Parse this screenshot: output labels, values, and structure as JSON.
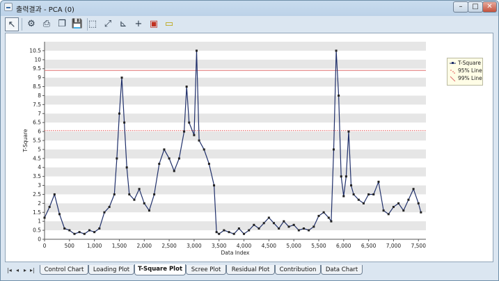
{
  "window": {
    "title": "출력결과 - PCA (0)"
  },
  "toolbar": {
    "items": [
      {
        "name": "pointer-icon",
        "glyph": "↖"
      },
      {
        "name": "properties-icon",
        "glyph": "⚙"
      },
      {
        "name": "print-icon",
        "glyph": "⎙"
      },
      {
        "name": "copy-icon",
        "glyph": "❐"
      },
      {
        "name": "save-icon",
        "glyph": "💾"
      },
      {
        "name": "zoom-icon",
        "glyph": "⬚"
      },
      {
        "name": "rescale-icon",
        "glyph": "⤢"
      },
      {
        "name": "axis-icon",
        "glyph": "⊾"
      },
      {
        "name": "crosshair-icon",
        "glyph": "+"
      },
      {
        "name": "export-icon",
        "glyph": "▣"
      },
      {
        "name": "label-icon",
        "glyph": "▭"
      }
    ]
  },
  "tabs": {
    "nav": [
      "|◂",
      "◂",
      "▸",
      "▸|"
    ],
    "items": [
      "Control Chart",
      "Loading Plot",
      "T-Square Plot",
      "Scree Plot",
      "Residual Plot",
      "Contribution",
      "Data Chart"
    ],
    "active": "T-Square Plot"
  },
  "chart_data": {
    "type": "line",
    "xlabel": "Data Index",
    "ylabel": "T-Square",
    "xlim": [
      0,
      7650
    ],
    "ylim": [
      0,
      11
    ],
    "xticks": [
      0,
      500,
      1000,
      1500,
      2000,
      2500,
      3000,
      3500,
      4000,
      4500,
      5000,
      5500,
      6000,
      6500,
      7000,
      7500
    ],
    "xtick_labels": [
      "0",
      "500",
      "1,000",
      "1,500",
      "2,000",
      "2,500",
      "3,000",
      "3,500",
      "4,000",
      "4,500",
      "5,000",
      "5,500",
      "6,000",
      "6,500",
      "7,000",
      "7,500"
    ],
    "yticks": [
      0,
      0.5,
      1,
      1.5,
      2,
      2.5,
      3,
      3.5,
      4,
      4.5,
      5,
      5.5,
      6,
      6.5,
      7,
      7.5,
      8,
      8.5,
      9,
      9.5,
      10,
      10.5
    ],
    "ytick_labels": [
      "0",
      "0.5",
      "1",
      "1.5",
      "2",
      "2.5",
      "3",
      "3.5",
      "4",
      "4.5",
      "5",
      "5.5",
      "6",
      "6.5",
      "7",
      "7.5",
      "8",
      "8.5",
      "9",
      "9.5",
      "10",
      "10.5"
    ],
    "grid": "horizontal bands",
    "legend_position": "right",
    "colors": {
      "series": "#1f2f6a",
      "limit95": "#e05050",
      "limit99": "#e07070",
      "band": "#e6e6e6"
    },
    "limits": [
      {
        "name": "95% Line",
        "value": 6.05,
        "style": "dotted"
      },
      {
        "name": "99% Line",
        "value": 9.4,
        "style": "solid"
      }
    ],
    "series": [
      {
        "name": "T-Square",
        "x": [
          0,
          100,
          200,
          300,
          400,
          500,
          600,
          700,
          800,
          900,
          1000,
          1100,
          1200,
          1300,
          1400,
          1450,
          1500,
          1550,
          1600,
          1650,
          1700,
          1800,
          1900,
          2000,
          2100,
          2200,
          2300,
          2400,
          2500,
          2600,
          2700,
          2800,
          2850,
          2900,
          3000,
          3050,
          3100,
          3200,
          3300,
          3400,
          3450,
          3500,
          3600,
          3700,
          3800,
          3900,
          4000,
          4100,
          4200,
          4300,
          4400,
          4500,
          4600,
          4700,
          4800,
          4900,
          5000,
          5100,
          5200,
          5300,
          5400,
          5500,
          5600,
          5700,
          5750,
          5800,
          5850,
          5900,
          5950,
          6000,
          6050,
          6100,
          6150,
          6200,
          6300,
          6400,
          6500,
          6600,
          6700,
          6800,
          6900,
          7000,
          7100,
          7200,
          7300,
          7400,
          7500,
          7550
        ],
        "values": [
          1.2,
          1.8,
          2.5,
          1.4,
          0.6,
          0.5,
          0.3,
          0.4,
          0.3,
          0.5,
          0.4,
          0.6,
          1.5,
          1.8,
          2.5,
          4.5,
          7.0,
          9.0,
          6.5,
          4.0,
          2.5,
          2.2,
          2.8,
          2.0,
          1.6,
          2.5,
          4.2,
          5.0,
          4.5,
          3.8,
          4.5,
          6.0,
          8.5,
          6.5,
          5.8,
          10.5,
          5.5,
          5.0,
          4.2,
          3.0,
          0.4,
          0.3,
          0.5,
          0.4,
          0.3,
          0.6,
          0.3,
          0.5,
          0.8,
          0.6,
          0.9,
          1.2,
          0.9,
          0.6,
          1.0,
          0.7,
          0.8,
          0.5,
          0.6,
          0.5,
          0.7,
          1.3,
          1.5,
          1.2,
          1.0,
          5.0,
          10.5,
          8.0,
          3.5,
          2.4,
          3.5,
          6.0,
          3.0,
          2.5,
          2.2,
          2.0,
          2.5,
          2.5,
          3.2,
          1.6,
          1.4,
          1.8,
          2.0,
          1.6,
          2.2,
          2.8,
          2.0,
          1.5
        ]
      }
    ]
  }
}
